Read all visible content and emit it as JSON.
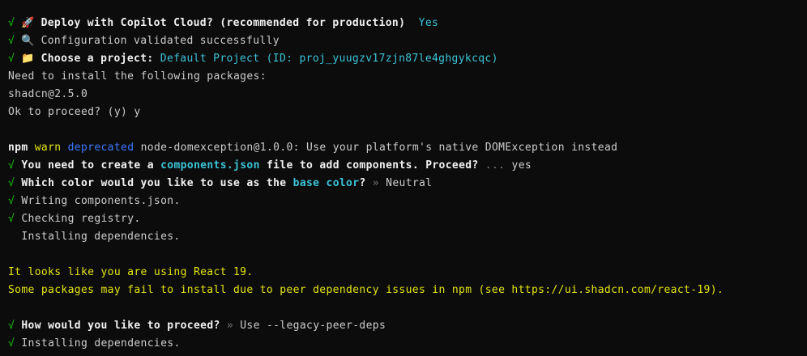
{
  "lines": {
    "l1": {
      "check": "√",
      "icon": "🚀",
      "prompt": "Deploy with Copilot Cloud? (recommended for production)",
      "answer": "Yes"
    },
    "l2": {
      "check": "√",
      "icon": "🔍",
      "text": "Configuration validated successfully"
    },
    "l3": {
      "check": "√",
      "icon": "📁",
      "prompt": "Choose a project:",
      "answer": "Default Project (ID: proj_yuugzv17zjn87le4ghgykcqc)"
    },
    "l4": {
      "text": "Need to install the following packages:"
    },
    "l5": {
      "text": "shadcn@2.5.0"
    },
    "l6": {
      "text": "Ok to proceed? (y) y"
    },
    "l8": {
      "npm": "npm",
      "warn": "warn",
      "deprecated": "deprecated",
      "text": "node-domexception@1.0.0: Use your platform's native DOMException instead"
    },
    "l9": {
      "check": "√",
      "prompt_a": "You need to create a",
      "highlight": "components.json",
      "prompt_b": "file to add components. Proceed?",
      "ellipsis": "...",
      "answer": "yes"
    },
    "l10": {
      "check": "√",
      "prompt_a": "Which color would you like to use as the",
      "highlight": "base color",
      "prompt_b": "?",
      "sep": "»",
      "answer": "Neutral"
    },
    "l11": {
      "check": "√",
      "text": "Writing components.json."
    },
    "l12": {
      "check": "√",
      "text": "Checking registry."
    },
    "l13": {
      "text": "Installing dependencies."
    },
    "l15": {
      "text": "It looks like you are using React 19."
    },
    "l16": {
      "text": "Some packages may fail to install due to peer dependency issues in npm (see https://ui.shadcn.com/react-19)."
    },
    "l18": {
      "check": "√",
      "prompt": "How would you like to proceed?",
      "sep": "»",
      "answer": "Use --legacy-peer-deps"
    },
    "l19": {
      "check": "√",
      "text": "Installing dependencies."
    }
  },
  "colors": {
    "background": "#0c0c0c",
    "green": "#16c60c",
    "cyan": "#3bc4d8",
    "blue": "#3b78ff",
    "yellow": "#f9f1a5"
  }
}
